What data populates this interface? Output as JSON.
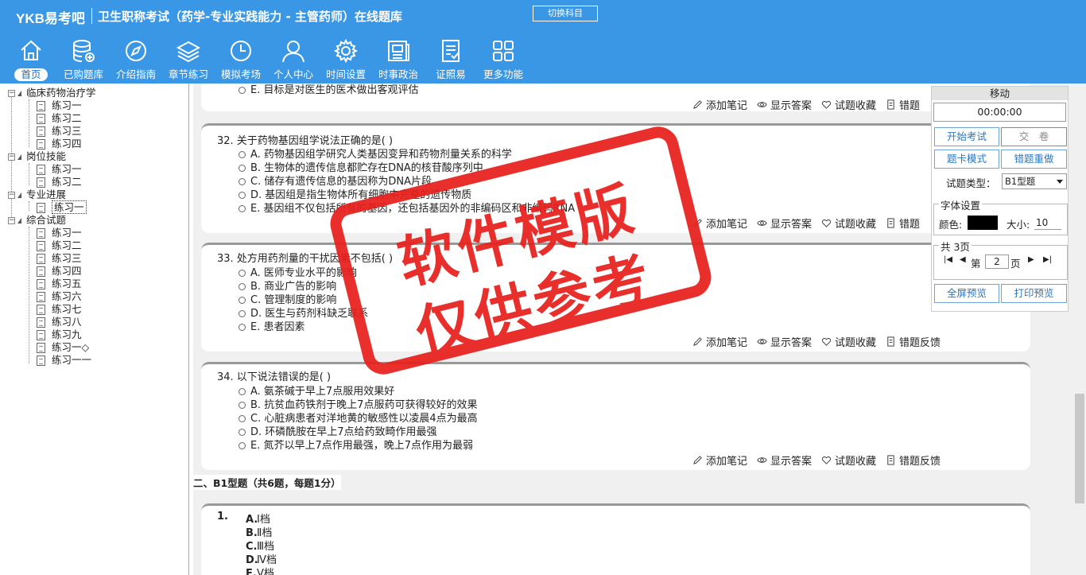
{
  "header": {
    "logo": "YKB易考吧",
    "title": "卫生职称考试（药学-专业实践能力 - 主管药师）在线题库",
    "switch_label": "切换科目"
  },
  "nav": [
    {
      "label": "首页",
      "icon": "home-icon"
    },
    {
      "label": "已购题库",
      "icon": "database-icon"
    },
    {
      "label": "介绍指南",
      "icon": "compass-icon"
    },
    {
      "label": "章节练习",
      "icon": "layers-icon"
    },
    {
      "label": "模拟考场",
      "icon": "clock-icon"
    },
    {
      "label": "个人中心",
      "icon": "user-icon"
    },
    {
      "label": "时间设置",
      "icon": "gear-icon"
    },
    {
      "label": "时事政治",
      "icon": "news-icon"
    },
    {
      "label": "证照易",
      "icon": "certificate-icon"
    },
    {
      "label": "更多功能",
      "icon": "grid-icon"
    }
  ],
  "tree": {
    "groups": [
      {
        "label": "临床药物治疗学",
        "items": [
          "练习一",
          "练习二",
          "练习三",
          "练习四"
        ]
      },
      {
        "label": "岗位技能",
        "items": [
          "练习一",
          "练习二"
        ]
      },
      {
        "label": "专业进展",
        "items": [
          "练习一"
        ]
      },
      {
        "label": "综合试题",
        "items": [
          "练习一",
          "练习二",
          "练习三",
          "练习四",
          "练习五",
          "练习六",
          "练习七",
          "练习八",
          "练习九",
          "练习一◇",
          "练习一一"
        ]
      }
    ]
  },
  "top_partial_option": "E. 目标是对医生的医术做出客观评估",
  "actions": {
    "note": "添加笔记",
    "answer": "显示答案",
    "fav": "试题收藏",
    "report": "错题反馈",
    "report_cut": "错题"
  },
  "questions": [
    {
      "title": "32. 关于药物基因组学说法正确的是( )",
      "options": [
        "A. 药物基因组学研究人类基因变异和药物剂量关系的科学",
        "B. 生物体的遗传信息都贮存在DNA的核苷酸序列中",
        "C. 储存有遗传信息的基因称为DNA片段",
        "D. 基因组是指生物体所有细胞中完整的遗传物质",
        "E. 基因组不仅包括所有的基因，还包括基因外的非编码区和非编码RNA"
      ]
    },
    {
      "title": "33. 处方用药剂量的干扰因素不包括( )",
      "options": [
        "A. 医师专业水平的影响",
        "B. 商业广告的影响",
        "C. 管理制度的影响",
        "D. 医生与药剂科缺乏联系",
        "E. 患者因素"
      ]
    },
    {
      "title": "34. 以下说法错误的是( )",
      "options": [
        "A. 氨茶碱于早上7点服用效果好",
        "B. 抗贫血药铁剂于晚上7点服药可获得较好的效果",
        "C. 心脏病患者对洋地黄的敏感性以凌晨4点为最高",
        "D. 环磷酰胺在早上7点给药致畸作用最强",
        "E. 氮芥以早上7点作用最强，晚上7点作用为最弱"
      ]
    }
  ],
  "section_title": "二、B1型题（共6题，每题1分）",
  "b1": {
    "number": "1.",
    "options": [
      {
        "key": "A.",
        "text": "Ⅰ档"
      },
      {
        "key": "B.",
        "text": "Ⅱ档"
      },
      {
        "key": "C.",
        "text": "Ⅲ档"
      },
      {
        "key": "D.",
        "text": "Ⅳ档"
      },
      {
        "key": "E.",
        "text": "Ⅴ档"
      }
    ]
  },
  "panel": {
    "move": "移动",
    "timer": "00:00:00",
    "start_exam": "开始考试",
    "submit": "交　卷",
    "card_mode": "题卡模式",
    "redo_wrong": "错题重做",
    "type_label": "试题类型：",
    "type_value": "B1型题",
    "font_legend": "字体设置",
    "color_label": "颜色:",
    "size_label": "大小:",
    "size_value": "10",
    "pages_legend": "共 3页",
    "page_prefix": "第",
    "page_value": "2",
    "page_suffix": "页",
    "fullscreen": "全屏预览",
    "print": "打印预览"
  },
  "watermark": {
    "line1": "软件模版",
    "line2": "仅供参考"
  },
  "colors": {
    "header": "#3a97e6",
    "stamp": "#e8201c"
  }
}
